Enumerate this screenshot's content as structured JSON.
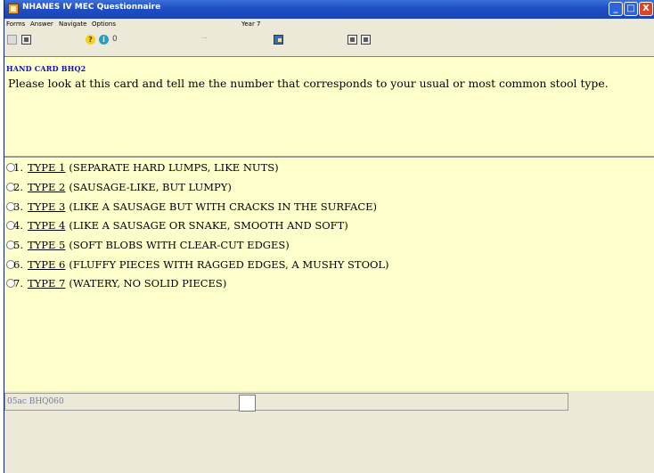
{
  "window": {
    "title": "NHANES IV MEC Questionnaire",
    "controls": {
      "minimize": "_",
      "maximize": "□",
      "close": "X"
    }
  },
  "menu": {
    "items": [
      "Forms",
      "Answer",
      "Navigate",
      "Options"
    ],
    "year": "Year 7"
  },
  "toolbar": {
    "help_glyph": "?",
    "info_glyph": "i",
    "clip_glyph": "0",
    "dots_glyph": "···"
  },
  "question": {
    "hand_card": "HAND CARD BHQ2",
    "text": "Please look at this card and tell me the number that corresponds to your usual or most common stool type."
  },
  "answers": [
    {
      "num": "1.",
      "type": "TYPE 1",
      "desc": "(SEPARATE HARD LUMPS, LIKE NUTS)"
    },
    {
      "num": "2.",
      "type": "TYPE 2",
      "desc": "(SAUSAGE-LIKE, BUT LUMPY)"
    },
    {
      "num": "3.",
      "type": "TYPE 3",
      "desc": "(LIKE A SAUSAGE BUT WITH CRACKS IN THE SURFACE)"
    },
    {
      "num": "4.",
      "type": "TYPE 4",
      "desc": "(LIKE A SAUSAGE OR SNAKE, SMOOTH AND SOFT)"
    },
    {
      "num": "5.",
      "type": "TYPE 5",
      "desc": "(SOFT BLOBS WITH CLEAR-CUT EDGES)"
    },
    {
      "num": "6.",
      "type": "TYPE 6",
      "desc": "(FLUFFY PIECES WITH RAGGED EDGES, A MUSHY STOOL)"
    },
    {
      "num": "7.",
      "type": "TYPE 7",
      "desc": "(WATERY, NO SOLID PIECES)"
    }
  ],
  "status": {
    "variable": "05ac BHQ060",
    "answer_value": ""
  }
}
